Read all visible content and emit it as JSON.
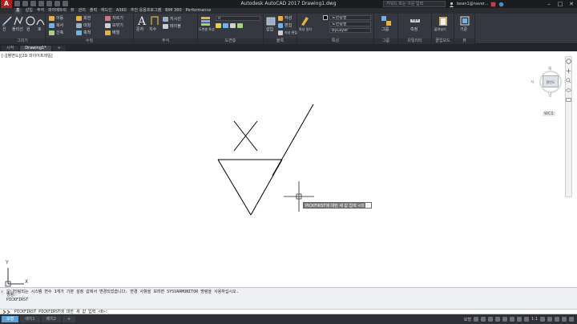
{
  "titlebar": {
    "app_letter": "A",
    "title": "Autodesk AutoCAD 2017    Drawing1.dwg",
    "search_placeholder": "키워드 또는 구문 입력",
    "user_name": "bean1@naver..."
  },
  "menubar": {
    "items": [
      "홈",
      "삽입",
      "주석",
      "파라메트릭",
      "뷰",
      "관리",
      "출력",
      "애드인",
      "A360",
      "추천 응용프로그램",
      "BIM 360",
      "Performance"
    ]
  },
  "ribbon": {
    "panels": {
      "draw": "그리기",
      "modify": "수정",
      "annotation": "주석",
      "layers": "도면층",
      "block": "블록",
      "properties": "특성",
      "groups": "그룹",
      "utilities": "유틸리티",
      "clipboard": "클립보드",
      "view": "뷰"
    },
    "draw_tools": [
      "선",
      "폴리선",
      "원",
      "호"
    ],
    "modify_tools": [
      "이동",
      "회전",
      "자르기",
      "복사",
      "대칭",
      "모깎기",
      "신축",
      "축척",
      "배열"
    ],
    "annotation_tools": [
      "문자",
      "치수",
      "지시선",
      "테이블"
    ],
    "layer_tools": [
      "도면층 특성"
    ],
    "layer_dropdown": "0",
    "block_tools": [
      "삽입",
      "작성",
      "편집",
      "속성 편집"
    ],
    "properties_tools": [
      "특성 일치"
    ],
    "prop_color": "도면층별",
    "prop_linetype": "도면층별",
    "prop_lineweight": "ByLayer",
    "group_tool": "그룹",
    "utility_tool": "측정",
    "clipboard_tool": "붙여넣기",
    "view_tool": "기준"
  },
  "filetabs": {
    "start": "시작",
    "drawing": "Drawing1*",
    "add": "+"
  },
  "viewport": {
    "label": "[-][평면도][2D 와이어프레임]",
    "viewcube_face": "평면도",
    "compass": {
      "n": "북",
      "s": "남",
      "e": "동",
      "w": "서"
    },
    "wcs": "WCS"
  },
  "ucs": {
    "x": "X",
    "y": "Y"
  },
  "tooltip": {
    "text": "PICKFIRST에 대한 새 값 입력 <0>:"
  },
  "command_history": [
    "모니터링되는 시스템 변수 1개가 기본 설정 값에서 변경되었습니다. 변경 사항을 보려면 SYSVARMONITOR 명령을 사용하십시오.",
    "명령:",
    "PICKFIRST"
  ],
  "command_line": {
    "text": "PICKFIRST PICKFIRST에 대한 새 값 입력 <0>:"
  },
  "layout_tabs": [
    "모형",
    "배치1",
    "배치2",
    "+"
  ],
  "statusbar": {
    "model": "모형",
    "scale": "1:1"
  }
}
